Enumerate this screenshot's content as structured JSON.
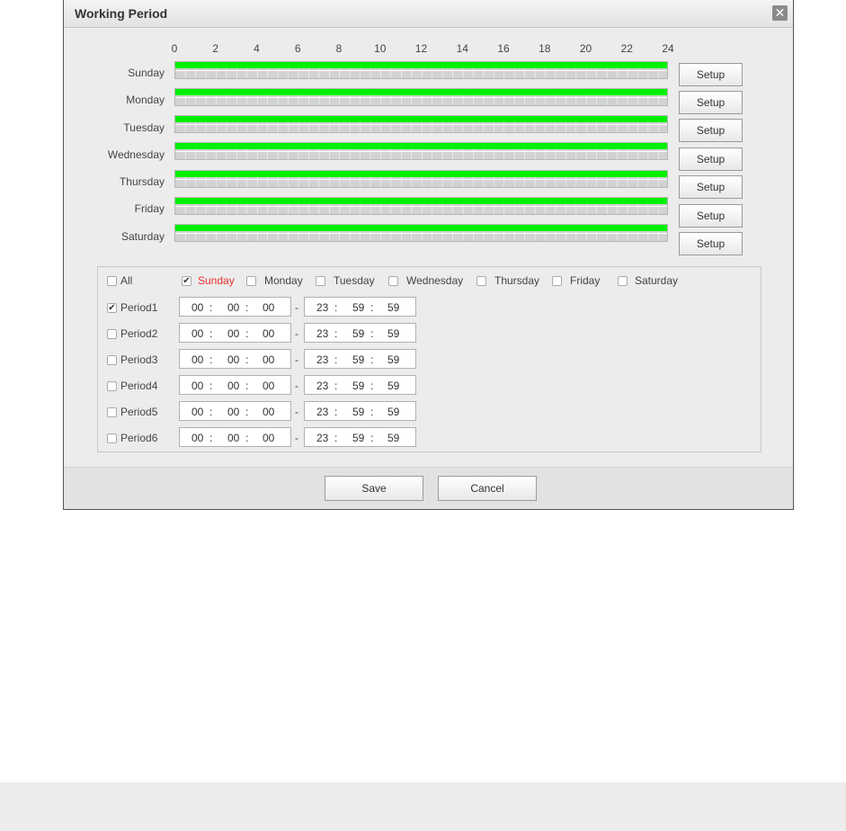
{
  "dialog": {
    "title": "Working Period",
    "close_icon": "✕"
  },
  "schedule": {
    "hour_ticks": [
      "0",
      "2",
      "4",
      "6",
      "8",
      "10",
      "12",
      "14",
      "16",
      "18",
      "20",
      "22",
      "24"
    ],
    "days": [
      {
        "label": "Sunday",
        "setup_label": "Setup",
        "active_fraction": 1.0
      },
      {
        "label": "Monday",
        "setup_label": "Setup",
        "active_fraction": 1.0
      },
      {
        "label": "Tuesday",
        "setup_label": "Setup",
        "active_fraction": 1.0
      },
      {
        "label": "Wednesday",
        "setup_label": "Setup",
        "active_fraction": 1.0
      },
      {
        "label": "Thursday",
        "setup_label": "Setup",
        "active_fraction": 1.0
      },
      {
        "label": "Friday",
        "setup_label": "Setup",
        "active_fraction": 1.0
      },
      {
        "label": "Saturday",
        "setup_label": "Setup",
        "active_fraction": 1.0
      }
    ],
    "active_color": "#00f000"
  },
  "day_select": {
    "all": {
      "label": "All",
      "checked": false
    },
    "days": [
      {
        "label": "Sunday",
        "checked": true
      },
      {
        "label": "Monday",
        "checked": false
      },
      {
        "label": "Tuesday",
        "checked": false
      },
      {
        "label": "Wednesday",
        "checked": false
      },
      {
        "label": "Thursday",
        "checked": false
      },
      {
        "label": "Friday",
        "checked": false
      },
      {
        "label": "Saturday",
        "checked": false
      }
    ],
    "selected_color": "#e8302d"
  },
  "periods": [
    {
      "label": "Period1",
      "checked": true,
      "start": [
        "00",
        "00",
        "00"
      ],
      "end": [
        "23",
        "59",
        "59"
      ]
    },
    {
      "label": "Period2",
      "checked": false,
      "start": [
        "00",
        "00",
        "00"
      ],
      "end": [
        "23",
        "59",
        "59"
      ]
    },
    {
      "label": "Period3",
      "checked": false,
      "start": [
        "00",
        "00",
        "00"
      ],
      "end": [
        "23",
        "59",
        "59"
      ]
    },
    {
      "label": "Period4",
      "checked": false,
      "start": [
        "00",
        "00",
        "00"
      ],
      "end": [
        "23",
        "59",
        "59"
      ]
    },
    {
      "label": "Period5",
      "checked": false,
      "start": [
        "00",
        "00",
        "00"
      ],
      "end": [
        "23",
        "59",
        "59"
      ]
    },
    {
      "label": "Period6",
      "checked": false,
      "start": [
        "00",
        "00",
        "00"
      ],
      "end": [
        "23",
        "59",
        "59"
      ]
    }
  ],
  "separators": {
    "colon": ":",
    "dash": "-"
  },
  "footer": {
    "save_label": "Save",
    "cancel_label": "Cancel"
  }
}
